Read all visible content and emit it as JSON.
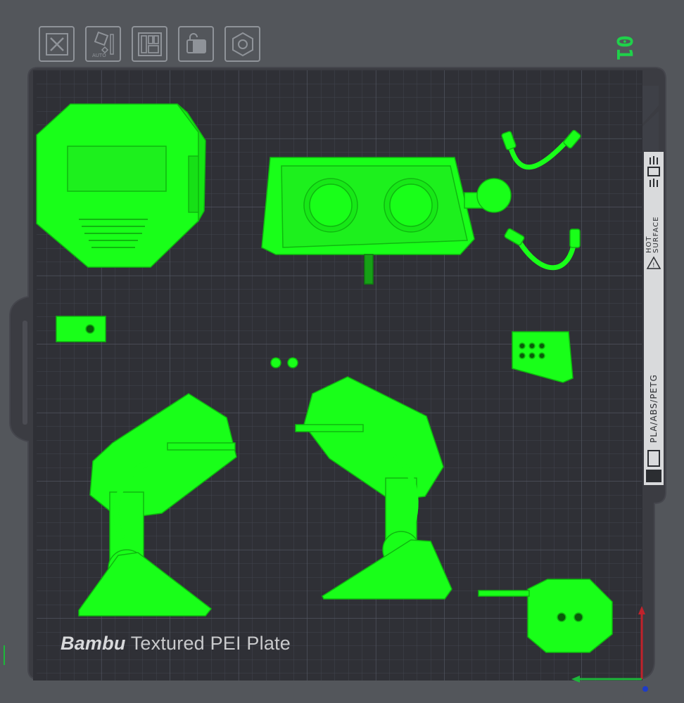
{
  "toolbar": {
    "items": [
      {
        "name": "close-button",
        "icon": "close-icon"
      },
      {
        "name": "auto-orient-button",
        "icon": "auto-orient-icon",
        "label": "AUTO"
      },
      {
        "name": "arrange-button",
        "icon": "arrange-icon"
      },
      {
        "name": "lock-button",
        "icon": "lock-icon"
      },
      {
        "name": "settings-button",
        "icon": "hex-nut-icon"
      }
    ],
    "auto_label": "AUTO"
  },
  "plate": {
    "number": "01",
    "title_brand": "Bambu",
    "title_rest": " Textured PEI Plate",
    "warning": "HOT SURFACE",
    "warning_line1": "HOT",
    "warning_line2": "SURFACE",
    "materials": "PLA/ABS/PETG"
  },
  "colors": {
    "background": "#53565b",
    "bed": "#2f3036",
    "grid": "#4a4d57",
    "model": "#19ff19",
    "accent_green": "#1fd14a",
    "axis_x": "#1db83a",
    "axis_y": "#c0222b"
  }
}
